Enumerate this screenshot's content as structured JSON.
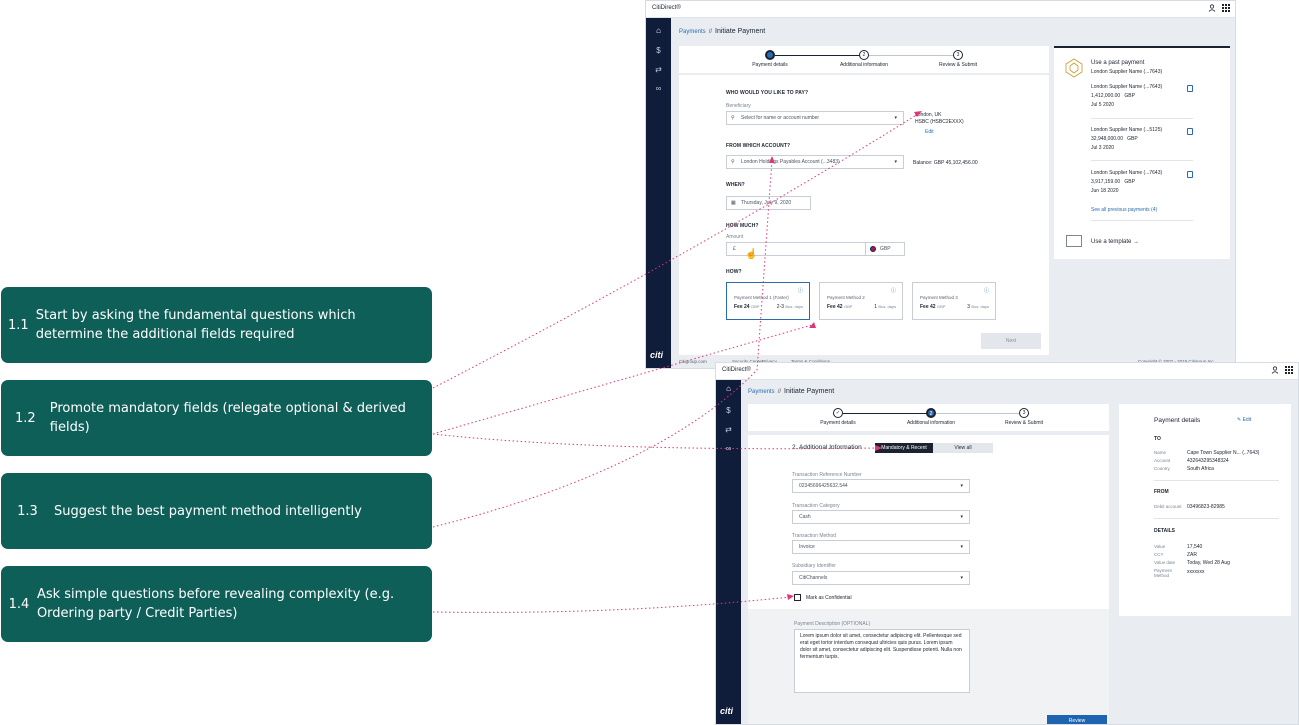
{
  "callouts": [
    {
      "num": "1.1",
      "text": "Start by asking the fundamental questions which determine the additional fields required"
    },
    {
      "num": "1.2",
      "text": "Promote mandatory fields (relegate optional & derived fields)"
    },
    {
      "num": "1.3",
      "text": "Suggest the best payment method intelligently"
    },
    {
      "num": "1.4",
      "text": "Ask simple questions before revealing complexity (e.g. Ordering party / Credit Parties)"
    }
  ],
  "screen1": {
    "brand": "CitiDirect®",
    "breadcrumb": {
      "parent": "Payments",
      "sep": "//",
      "current": "Initiate Payment"
    },
    "steps": [
      "Payment details",
      "Additional information",
      "Review & Submit"
    ],
    "step_numbers": [
      "1",
      "2",
      "3"
    ],
    "form": {
      "q_who": "WHO WOULD YOU LIKE TO PAY?",
      "beneficiary_label": "Beneficiary",
      "beneficiary_placeholder": "Select for name or account number",
      "beneficiary_info_line1": "London, UK",
      "beneficiary_info_line2": "HSBC (HSBC2EXXX)",
      "edit": "Edit",
      "q_from": "FROM WHICH ACCOUNT?",
      "account_value": "London Holdings Payables Account (...3483)",
      "balance": "Balance: GBP 45,102,456.00",
      "q_when": "WHEN?",
      "date_value": "Thursday, July 9, 2020",
      "q_much": "HOW MUCH?",
      "amount_label": "Amount",
      "amount_value": "£",
      "currency": "GBP",
      "q_how": "HOW?",
      "methods": [
        {
          "name": "Payment Method 1 (Faster)",
          "fee": "Fee 24",
          "fee_unit": "GBP",
          "days": "2-3",
          "days_unit": "Bus. days"
        },
        {
          "name": "Payment Method 2",
          "fee": "Fee 42",
          "fee_unit": "GBP",
          "days": "1",
          "days_unit": "Bus. days"
        },
        {
          "name": "Payment Method 3",
          "fee": "Fee 42",
          "fee_unit": "GBP",
          "days": "3",
          "days_unit": "Bus. days"
        }
      ],
      "next": "Next"
    },
    "past": {
      "title": "Use a past payment",
      "subtitle": "London Supplier Name (...7643)",
      "items": [
        {
          "name": "London Supplier Name (...7643)",
          "amount": "1,412,000.00",
          "cur": "GBP",
          "date": "Jul 5 2020"
        },
        {
          "name": "London Supplier Name (...5125)",
          "amount": "32,948,000.00",
          "cur": "GBP",
          "date": "Jul 3 2020"
        },
        {
          "name": "London Supplier Name (...7643)",
          "amount": "3,917,159.00",
          "cur": "GBP",
          "date": "Jun 18 2020"
        }
      ],
      "see_all": "See all previous payments (4)",
      "template": "Use a template"
    },
    "footer": [
      "Citigroup.com",
      "Security Center",
      "Privacy",
      "Terms & Conditions"
    ],
    "copyright": "Copyright © 2007 - 2019 Citigroup Inc.",
    "logo": "citi"
  },
  "screen2": {
    "brand": "CitiDirect®",
    "breadcrumb": {
      "parent": "Payments",
      "sep": "//",
      "current": "Initiate Payment"
    },
    "steps": [
      "Payment details",
      "Additional information",
      "Review & Submit"
    ],
    "step_numbers": [
      "✓",
      "2",
      "3"
    ],
    "section_title": "2. Additional Information",
    "toggle_on": "Mandatory & Recent",
    "toggle_off": "View all",
    "fields": [
      {
        "label": "Transaction Reference Number",
        "value": "02345696425632.544"
      },
      {
        "label": "Transaction Category",
        "value": "Cash"
      },
      {
        "label": "Transaction Method",
        "value": "Invoice"
      },
      {
        "label": "Subsidiary Identifier",
        "value": "CitiChannels"
      }
    ],
    "checkbox_label": "Mark as Confidential",
    "desc_label": "Payment Description (OPTIONAL)",
    "desc_text": "Lorem ipsum dolor sit amet, consectetur adipiscing elit. Pellentesque sed erat eget tortor interdum consequat ultricies quis purus. Lorem ipsum dolor sit amet, consectetur adipiscing elit. Suspendisse potenti. Nulla non fermentum turpis.",
    "review": "Review",
    "logo": "citi",
    "details": {
      "title": "Payment details",
      "edit": "Edit",
      "to": "TO",
      "to_rows": [
        {
          "k": "Name",
          "v": "Cape Town Supplier N... (..7643)"
        },
        {
          "k": "Account",
          "v": "432643295348324"
        },
        {
          "k": "Country",
          "v": "South Africa"
        }
      ],
      "from": "FROM",
      "from_rows": [
        {
          "k": "Debit account",
          "v": "03496823-82985"
        }
      ],
      "details": "DETAILS",
      "detail_rows": [
        {
          "k": "Value",
          "v": "17,540"
        },
        {
          "k": "CCY",
          "v": "ZAR"
        },
        {
          "k": "Value date",
          "v": "Today, Wed 28 Aug"
        },
        {
          "k": "Payment Method",
          "v": "xxxxxxx"
        }
      ]
    }
  },
  "colors": {
    "callout_bg": "#0f5f59",
    "rail": "#0f1c3a",
    "accent_blue": "#2a6bb0",
    "connector": "#e0357a"
  }
}
